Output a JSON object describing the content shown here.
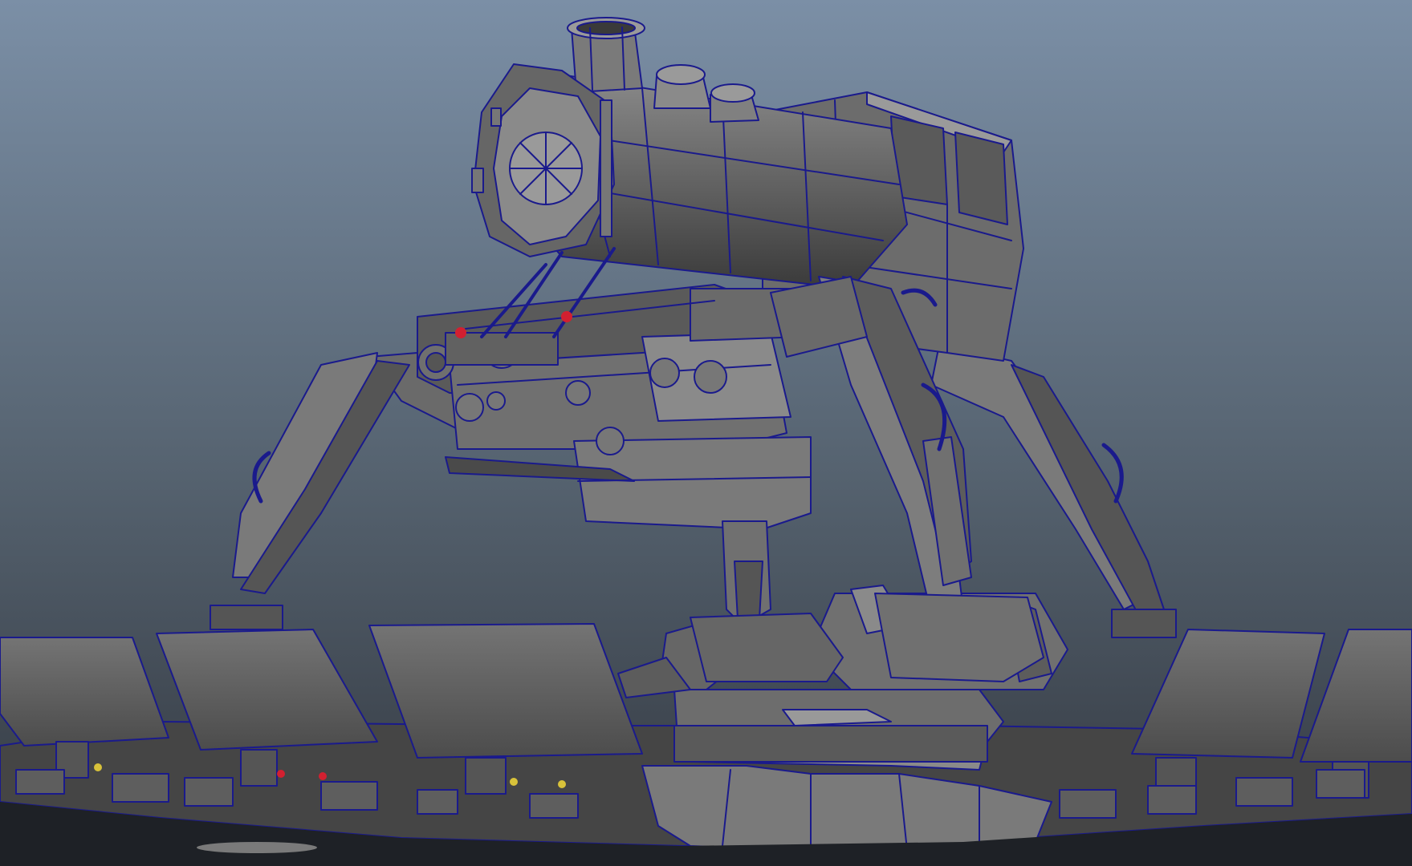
{
  "viewport": {
    "background_top": "#7b8fa6",
    "background_mid": "#55626f",
    "background_bottom": "#333840",
    "ground_color": "#1e2126",
    "mesh_light": "#8a8a8a",
    "mesh_mid": "#6f6f6f",
    "mesh_dark": "#4a4a4a",
    "mesh_shadow": "#2d2d2d",
    "wireframe_color": "#1a1a8c",
    "light_red": "#d22030",
    "light_yellow": "#d8c23a"
  },
  "scene": {
    "subject": "walking-steam-locomotive-wireframe-model",
    "icons": [
      "smokestack-icon",
      "boiler-front-icon",
      "cab-icon",
      "gear-icon",
      "leg-icon",
      "panel-icon",
      "platform-icon"
    ]
  }
}
